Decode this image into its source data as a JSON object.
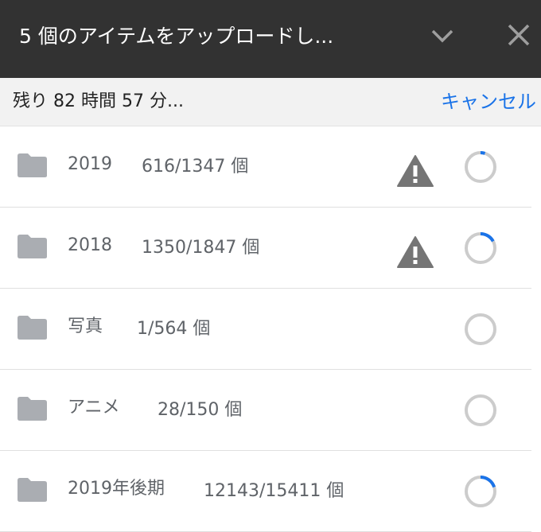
{
  "header": {
    "title": "5 個のアイテムをアップロードし...",
    "collapse_icon": "chevron-down-icon",
    "close_icon": "close-icon"
  },
  "status": {
    "remaining": "残り 82 時間 57 分...",
    "cancel_label": "キャンセル"
  },
  "colors": {
    "header_bg": "#323232",
    "accent": "#1a73e8",
    "warning": "#757575",
    "folder": "#aaadb2"
  },
  "items": [
    {
      "name": "2019",
      "count": "616/1347 個",
      "warning": true,
      "progress": 0.05
    },
    {
      "name": "2018",
      "count": "1350/1847 個",
      "warning": true,
      "progress": 0.17
    },
    {
      "name": "写真",
      "count": "1/564 個",
      "warning": false,
      "progress": 0.0
    },
    {
      "name": "アニメ",
      "count": "28/150 個",
      "warning": false,
      "progress": 0.0
    },
    {
      "name": "2019年後期",
      "count": "12143/15411 個",
      "warning": false,
      "progress": 0.2
    }
  ]
}
